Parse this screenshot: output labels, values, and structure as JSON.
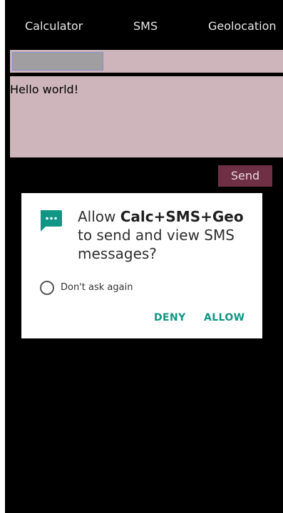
{
  "tabs": [
    {
      "label": "Calculator"
    },
    {
      "label": "SMS"
    },
    {
      "label": "Geolocation"
    }
  ],
  "phone_input": {
    "value": "",
    "placeholder": ""
  },
  "message": {
    "text": "Hello world!"
  },
  "send_button": {
    "label": "Send"
  },
  "dialog": {
    "title_prefix": "Allow ",
    "app_name": "Calc+SMS+Geo",
    "title_suffix": " to send and view SMS messages?",
    "dont_ask_label": "Don't ask again",
    "deny_label": "DENY",
    "allow_label": "ALLOW",
    "icon": "sms-icon"
  },
  "colors": {
    "accent": "#119584",
    "send_button": "#6f3046",
    "field_background": "#cdb5bb"
  }
}
